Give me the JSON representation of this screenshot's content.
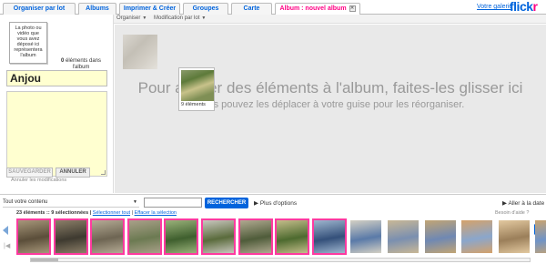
{
  "tabs": [
    {
      "label": "Organiser par lot"
    },
    {
      "label": "Albums"
    },
    {
      "label": "Imprimer & Créer"
    },
    {
      "label": "Groupes"
    },
    {
      "label": "Carte"
    },
    {
      "label": "Album : nouvel album",
      "active": true
    }
  ],
  "header": {
    "gallery_link": "Votre galerie",
    "logo_a": "flickr",
    "logo_b": "r"
  },
  "subbar": {
    "organiser": "Organiser",
    "modification": "Modification par lot"
  },
  "left": {
    "thumb_placeholder": "La photo ou vidéo que vous avez déposé ici représentera l'album",
    "count_number": "0",
    "count_text": "éléments dans l'album",
    "title_value": "Anjou",
    "save_label": "SAUVEGARDER",
    "cancel_label": "ANNULER",
    "cancel_changes": "Annuler les modifications"
  },
  "drop": {
    "main_text": "Pour ajouter des éléments à l'album, faites-les glisser ici",
    "sub_text": "Vous pouvez les déplacer à votre guise pour les réorganiser.",
    "drag_count": "9 éléments"
  },
  "search": {
    "scope": "Tout votre contenu",
    "button": "RECHERCHER",
    "more_options": "Plus d'options",
    "goto_date": "Aller à la date"
  },
  "strip": {
    "info_count": "23 éléments :: 9 sélectionnées |",
    "select_all": "Sélectionner tout",
    "clear_selection": "Effacer la sélection",
    "help": "Besoin d'aide ?",
    "photos": [
      {
        "selected": true,
        "c1": "#5b4e3a",
        "c2": "#a7977a"
      },
      {
        "selected": true,
        "c1": "#3e3a30",
        "c2": "#8c7f68"
      },
      {
        "selected": true,
        "c1": "#6e6553",
        "c2": "#b5ab95"
      },
      {
        "selected": true,
        "c1": "#6c7a52",
        "c2": "#a9a089"
      },
      {
        "selected": true,
        "c1": "#3f5f2e",
        "c2": "#9ab27a"
      },
      {
        "selected": true,
        "c1": "#5a6b3c",
        "c2": "#c9c7bf"
      },
      {
        "selected": true,
        "c1": "#4f5c3a",
        "c2": "#b0a990"
      },
      {
        "selected": true,
        "c1": "#4d6a2f",
        "c2": "#c4bd8a"
      },
      {
        "selected": true,
        "c1": "#34507a",
        "c2": "#9fb6cf"
      },
      {
        "selected": false,
        "c1": "#5a7aa8",
        "c2": "#d4d0c4"
      },
      {
        "selected": false,
        "c1": "#7a8fb0",
        "c2": "#c9b896"
      },
      {
        "selected": false,
        "c1": "#6f88b3",
        "c2": "#c2a574"
      },
      {
        "selected": false,
        "c1": "#8aa6cc",
        "c2": "#d5a26a"
      },
      {
        "selected": false,
        "c1": "#9b7f5a",
        "c2": "#e3c9a0"
      },
      {
        "selected": false,
        "c1": "#6f93c7",
        "c2": "#caa46f"
      }
    ]
  }
}
